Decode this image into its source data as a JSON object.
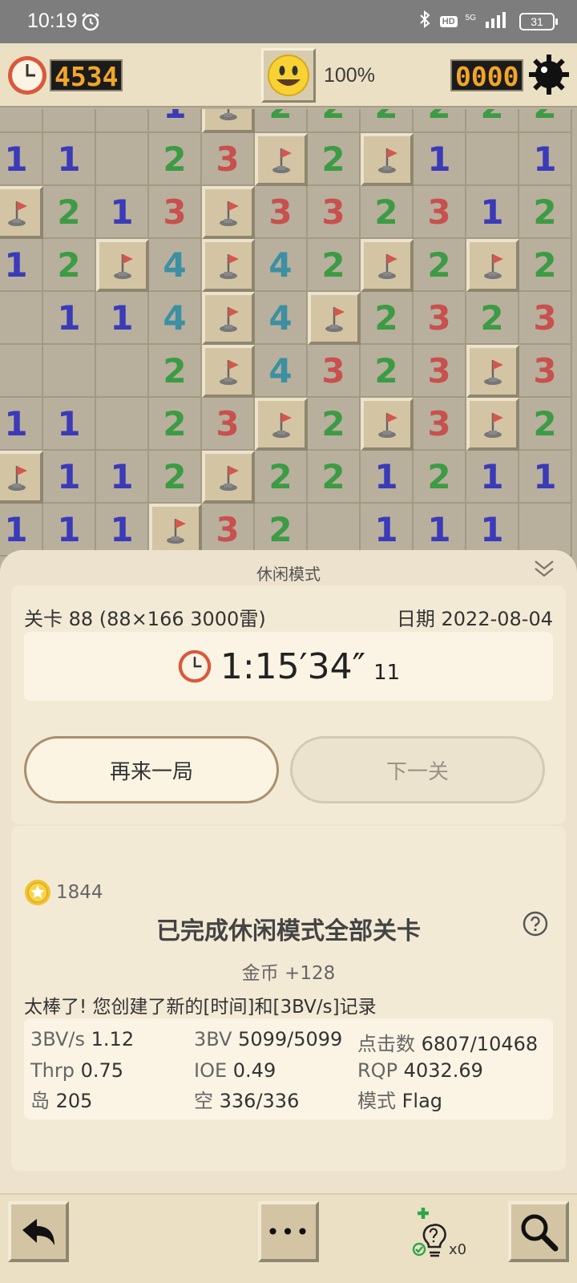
{
  "status_bar": {
    "time": "10:19",
    "hd": "HD",
    "network": "5G",
    "battery": "31"
  },
  "game_bar": {
    "time_counter": "4534",
    "progress": "100%",
    "mine_counter": "0000"
  },
  "board": {
    "rows": [
      [
        {
          "v": ""
        },
        {
          "v": ""
        },
        {
          "v": ""
        },
        {
          "v": "1"
        },
        {
          "v": "F"
        },
        {
          "v": "2"
        },
        {
          "v": "2"
        },
        {
          "v": "2"
        },
        {
          "v": "2"
        },
        {
          "v": "2"
        },
        {
          "v": "2"
        }
      ],
      [
        {
          "v": "1"
        },
        {
          "v": "1"
        },
        {
          "v": ""
        },
        {
          "v": "2"
        },
        {
          "v": "3"
        },
        {
          "v": "F"
        },
        {
          "v": "2"
        },
        {
          "v": "F"
        },
        {
          "v": "1"
        },
        {
          "v": ""
        },
        {
          "v": "1"
        }
      ],
      [
        {
          "v": "F"
        },
        {
          "v": "2"
        },
        {
          "v": "1"
        },
        {
          "v": "3"
        },
        {
          "v": "F"
        },
        {
          "v": "3"
        },
        {
          "v": "3"
        },
        {
          "v": "2"
        },
        {
          "v": "3"
        },
        {
          "v": "1"
        },
        {
          "v": "2"
        }
      ],
      [
        {
          "v": "1"
        },
        {
          "v": "2"
        },
        {
          "v": "F"
        },
        {
          "v": "4"
        },
        {
          "v": "F"
        },
        {
          "v": "4"
        },
        {
          "v": "2"
        },
        {
          "v": "F"
        },
        {
          "v": "2"
        },
        {
          "v": "F"
        },
        {
          "v": "2"
        }
      ],
      [
        {
          "v": ""
        },
        {
          "v": "1"
        },
        {
          "v": "1"
        },
        {
          "v": "4"
        },
        {
          "v": "F"
        },
        {
          "v": "4"
        },
        {
          "v": "F"
        },
        {
          "v": "2"
        },
        {
          "v": "3"
        },
        {
          "v": "2"
        },
        {
          "v": "3"
        }
      ],
      [
        {
          "v": ""
        },
        {
          "v": ""
        },
        {
          "v": ""
        },
        {
          "v": "2"
        },
        {
          "v": "F"
        },
        {
          "v": "4"
        },
        {
          "v": "3"
        },
        {
          "v": "2"
        },
        {
          "v": "3"
        },
        {
          "v": "F"
        },
        {
          "v": "3"
        }
      ],
      [
        {
          "v": "1"
        },
        {
          "v": "1"
        },
        {
          "v": ""
        },
        {
          "v": "2"
        },
        {
          "v": "3"
        },
        {
          "v": "F"
        },
        {
          "v": "2"
        },
        {
          "v": "F"
        },
        {
          "v": "3"
        },
        {
          "v": "F"
        },
        {
          "v": "2"
        }
      ],
      [
        {
          "v": "F"
        },
        {
          "v": "1"
        },
        {
          "v": "1"
        },
        {
          "v": "2"
        },
        {
          "v": "F"
        },
        {
          "v": "2"
        },
        {
          "v": "2"
        },
        {
          "v": "1"
        },
        {
          "v": "2"
        },
        {
          "v": "1"
        },
        {
          "v": "1"
        }
      ],
      [
        {
          "v": "1"
        },
        {
          "v": "1"
        },
        {
          "v": "1"
        },
        {
          "v": "F"
        },
        {
          "v": "3"
        },
        {
          "v": "2"
        },
        {
          "v": ""
        },
        {
          "v": "1"
        },
        {
          "v": "1"
        },
        {
          "v": "1"
        },
        {
          "v": ""
        }
      ]
    ]
  },
  "panel": {
    "title": "休闲模式",
    "level": "关卡 88 (88×166  3000雷)",
    "date": "日期 2022-08-04",
    "time_main": "1:15′34″",
    "time_frac": "11",
    "play_again": "再来一局",
    "next_level": "下一关",
    "coins": "1844",
    "complete": "已完成休闲模式全部关卡",
    "reward": "金币 +128",
    "record": "太棒了! 您创建了新的[时间]和[3BV/s]记录",
    "stats": [
      {
        "k": "3BV/s",
        "v": "1.12"
      },
      {
        "k": "3BV",
        "v": "5099/5099"
      },
      {
        "k": "点击数",
        "v": "6807/10468"
      },
      {
        "k": "Thrp",
        "v": "0.75"
      },
      {
        "k": "IOE",
        "v": "0.49"
      },
      {
        "k": "RQP",
        "v": "4032.69"
      },
      {
        "k": "岛",
        "v": "205"
      },
      {
        "k": "空",
        "v": "336/336"
      },
      {
        "k": "模式",
        "v": "Flag"
      }
    ]
  },
  "toolbar": {
    "more_label": "•••",
    "hint_count": "x0"
  }
}
